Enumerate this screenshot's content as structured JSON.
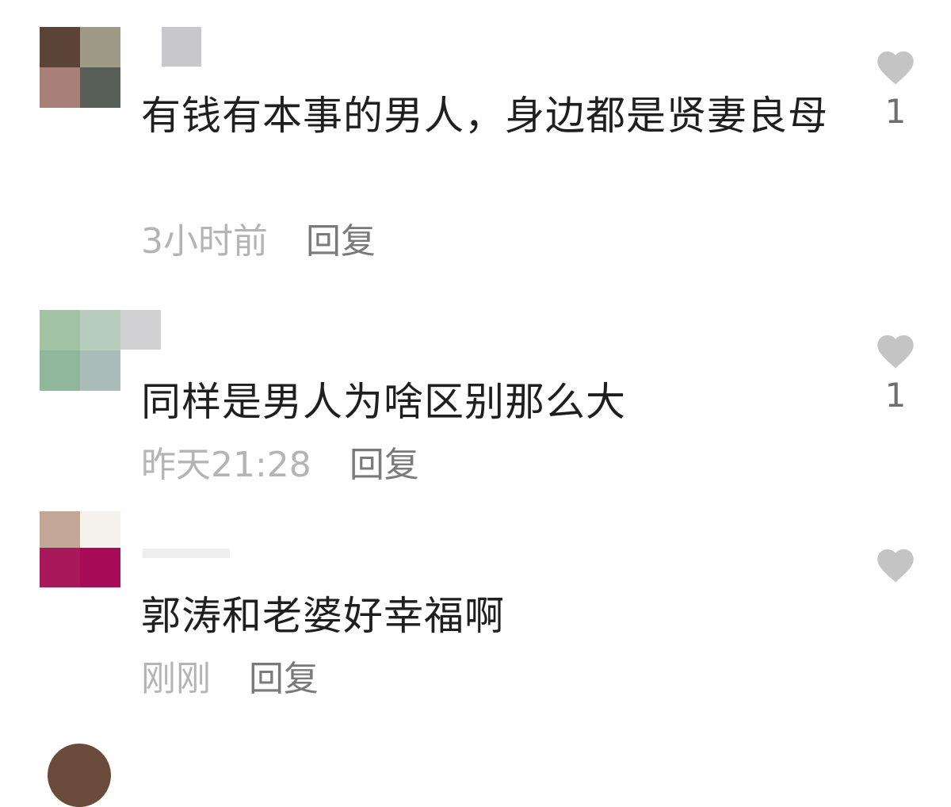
{
  "comments": [
    {
      "avatar_colors": [
        "#5b4336",
        "#9e9a86",
        "#a88077",
        "#585e58"
      ],
      "username_blur_color": "#c8c8cc",
      "text": "有钱有本事的男人，身边都是贤妻良母",
      "time": "3小时前",
      "reply_label": "回复",
      "likes": "1",
      "like_icon": "heart-icon"
    },
    {
      "avatar_colors": [
        "#a2c2a6",
        "#b6cdbe",
        "#90b69b",
        "#a9bcb7"
      ],
      "username_blur_color": "#d2d2d4",
      "text": "同样是男人为啥区别那么大",
      "time": "昨天21:28",
      "reply_label": "回复",
      "likes": "1",
      "like_icon": "heart-icon"
    },
    {
      "avatar_colors": [
        "#c4a696",
        "#f5f2ee",
        "#a8195c",
        "#a80c58"
      ],
      "username_blur_color": "#eeeeee",
      "text": "郭涛和老婆好幸福啊",
      "time": "刚刚",
      "reply_label": "回复",
      "likes": "",
      "like_icon": "heart-icon"
    }
  ],
  "colors": {
    "heart": "#c4c4c4",
    "time": "#b4b4b4",
    "reply": "#7a7a7a",
    "text": "#1f1f1f"
  }
}
